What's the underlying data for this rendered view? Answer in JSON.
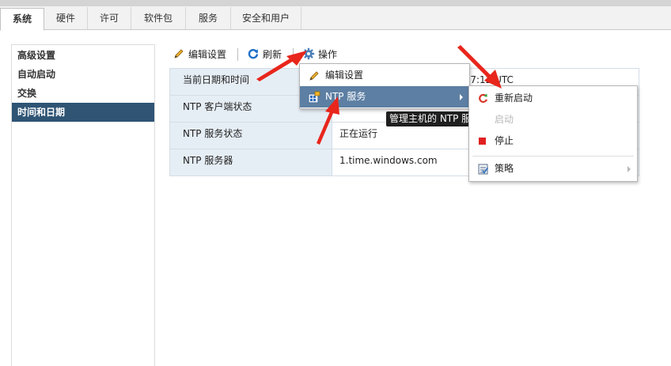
{
  "tabs": [
    {
      "label": "系统",
      "active": true
    },
    {
      "label": "硬件"
    },
    {
      "label": "许可"
    },
    {
      "label": "软件包"
    },
    {
      "label": "服务"
    },
    {
      "label": "安全和用户"
    }
  ],
  "sidebar": {
    "items": [
      {
        "label": "高级设置"
      },
      {
        "label": "自动启动"
      },
      {
        "label": "交换"
      },
      {
        "label": "时间和日期",
        "active": true
      }
    ]
  },
  "toolbar": {
    "edit_label": "编辑设置",
    "refresh_label": "刷新",
    "actions_label": "操作"
  },
  "table": {
    "rows": [
      {
        "key": "当前日期和时间",
        "value": "5:27:12 UTC"
      },
      {
        "key": "NTP 客户端状态",
        "value": ""
      },
      {
        "key": "NTP 服务状态",
        "value": "正在运行"
      },
      {
        "key": "NTP 服务器",
        "value": "1.time.windows.com"
      }
    ]
  },
  "actions_menu": {
    "items": [
      {
        "label": "编辑设置",
        "icon": "pencil-icon"
      },
      {
        "label": "NTP 服务",
        "icon": "ntp-service-icon",
        "has_submenu": true,
        "highlighted": true
      }
    ]
  },
  "tooltip": {
    "text": "管理主机的 NTP 服务"
  },
  "ntp_submenu": {
    "items": [
      {
        "label": "重新启动",
        "icon": "restart-icon",
        "enabled": true
      },
      {
        "label": "启动",
        "icon": "start-icon",
        "enabled": false
      },
      {
        "label": "停止",
        "icon": "stop-icon",
        "enabled": true
      },
      {
        "label": "策略",
        "icon": "policy-icon",
        "enabled": true,
        "has_submenu": true
      }
    ]
  },
  "colors": {
    "sidebar_active": "#2f5474",
    "menu_highlight": "#5d7fa3",
    "table_key_bg": "#e6eef5",
    "annotation_red": "#e8261c",
    "stop_red": "#e02020"
  }
}
